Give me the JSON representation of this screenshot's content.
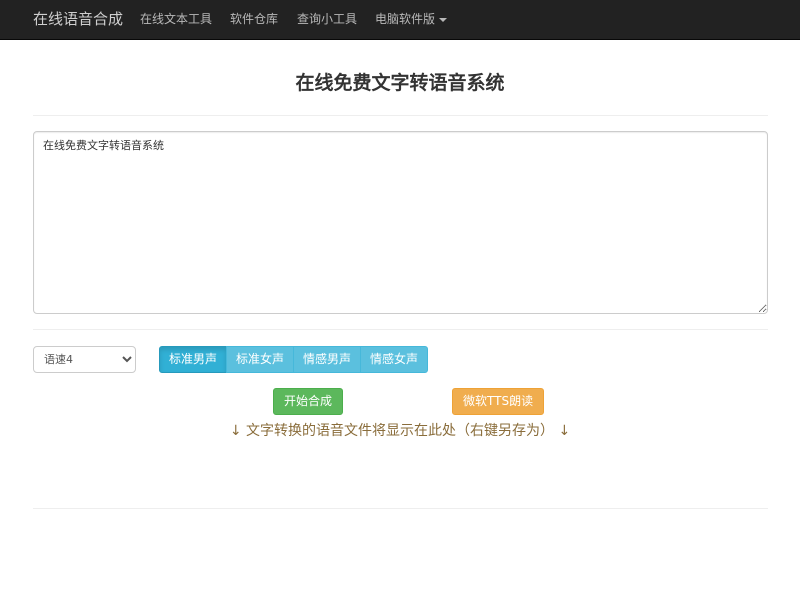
{
  "nav": {
    "brand": "在线语音合成",
    "items": [
      {
        "label": "在线文本工具"
      },
      {
        "label": "软件仓库"
      },
      {
        "label": "查询小工具"
      },
      {
        "label": "电脑软件版"
      }
    ]
  },
  "page": {
    "title": "在线免费文字转语音系统"
  },
  "editor": {
    "value": "在线免费文字转语音系统"
  },
  "controls": {
    "speed_selected": "语速4",
    "voices": [
      {
        "label": "标准男声",
        "active": true
      },
      {
        "label": "标准女声",
        "active": false
      },
      {
        "label": "情感男声",
        "active": false
      },
      {
        "label": "情感女声",
        "active": false
      }
    ],
    "synthesize_label": "开始合成",
    "tts_label": "微软TTS朗读"
  },
  "hint": "↓ 文字转换的语音文件将显示在此处（右键另存为） ↓",
  "colors": {
    "navbar": "#222222",
    "info": "#5bc0de",
    "success": "#5cb85c",
    "warning": "#f0ad4e",
    "hint_text": "#8a6d3b"
  }
}
